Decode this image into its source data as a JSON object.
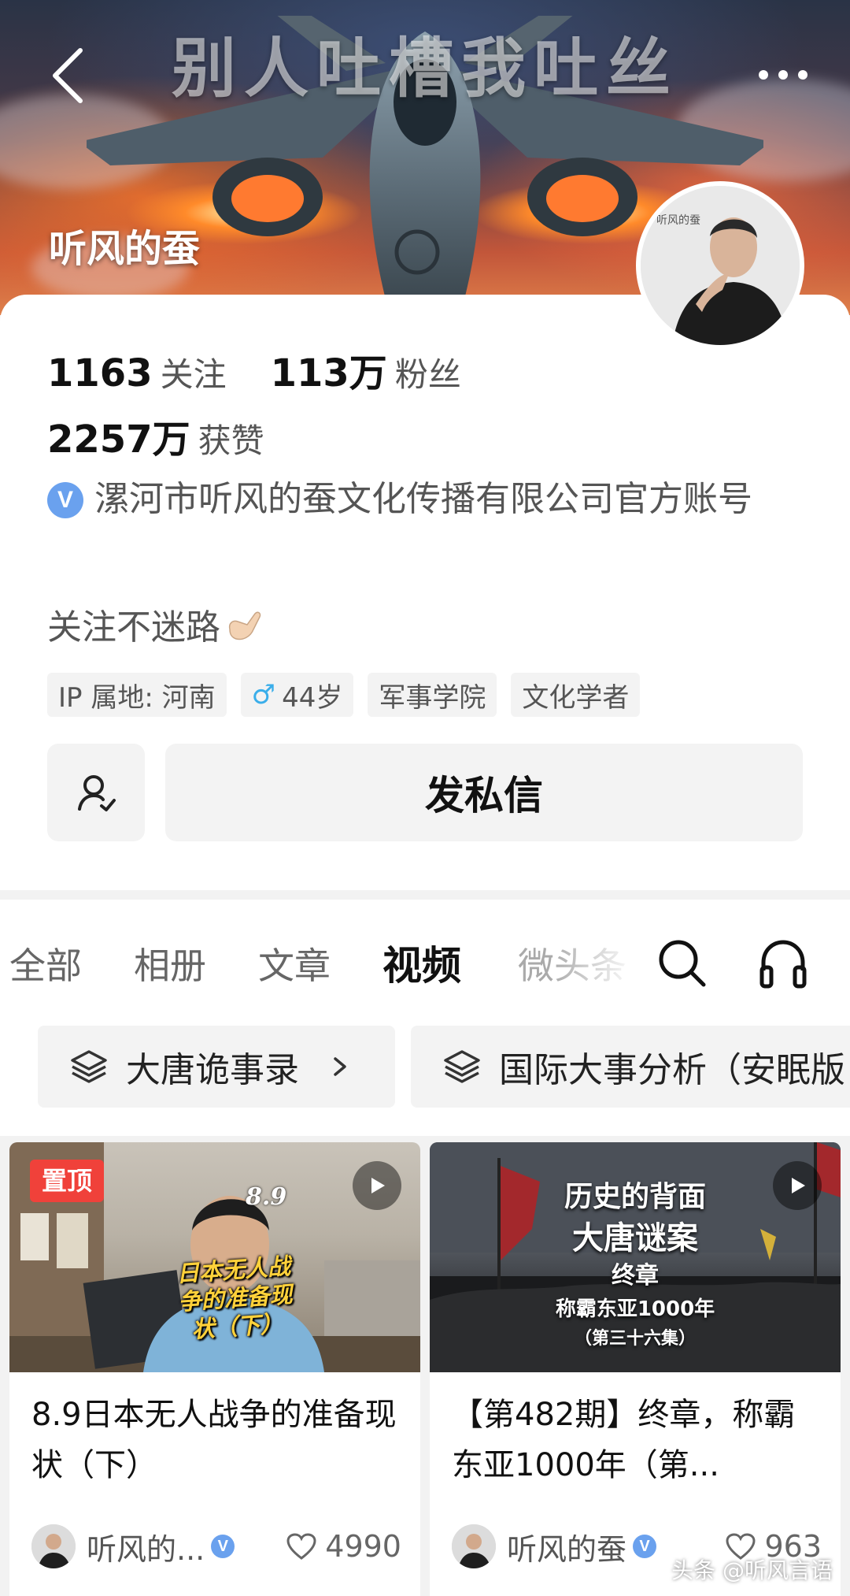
{
  "banner": {
    "headline": "别人吐槽我吐丝",
    "profile_name": "听风的蚕"
  },
  "stats": {
    "following_count": "1163",
    "following_label": "关注",
    "followers_count": "113万",
    "followers_label": "粉丝",
    "likes_count": "2257万",
    "likes_label": "获赞"
  },
  "verification": {
    "badge": "V",
    "text": "漯河市听风的蚕文化传播有限公司官方账号"
  },
  "bio": "关注不迷路",
  "tags": {
    "ip": "IP 属地: 河南",
    "age_symbol": "♂",
    "age": "44岁",
    "school": "军事学院",
    "role": "文化学者"
  },
  "actions": {
    "dm_label": "发私信"
  },
  "tabs": [
    {
      "label": "全部"
    },
    {
      "label": "相册"
    },
    {
      "label": "文章"
    },
    {
      "label": "视频",
      "active": true
    },
    {
      "label": "微头条"
    }
  ],
  "collections": [
    {
      "label": "大唐诡事录"
    },
    {
      "label": "国际大事分析（安眠版"
    }
  ],
  "videos": [
    {
      "pinned_label": "置顶",
      "thumb_date": "8.9",
      "thumb_caption": "日本无人战争的准备现状（下）",
      "title": "8.9日本无人战争的准备现状（下）",
      "author": "听风的...",
      "likes": "4990"
    },
    {
      "thumb_lines": [
        "历史的背面",
        "大唐谜案",
        "终章",
        "称霸东亚1000年",
        "（第三十六集）"
      ],
      "title": "【第482期】终章，称霸东亚1000年（第...",
      "author": "听风的蚕",
      "likes": "963"
    }
  ],
  "watermark": "头条 @听风言语",
  "colors": {
    "accent_verify": "#6aa1ee",
    "pin_red": "#f0413a",
    "male_blue": "#3aaeea"
  }
}
